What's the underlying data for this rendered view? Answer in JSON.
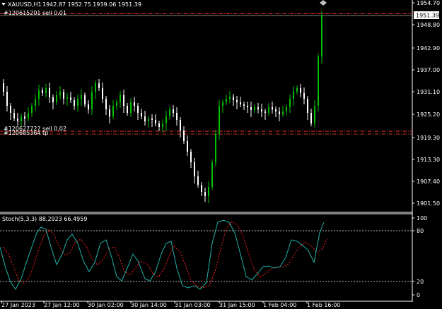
{
  "header": {
    "menu_icon": "triangle-down-icon",
    "symbol_label": "XAUUSD,H1",
    "ohlc_label": "1942.87 1952.75 1939.06 1951.39"
  },
  "orders": [
    {
      "label": "#120615201 sell 0.01"
    },
    {
      "label": "#120627727 sell 0.02"
    },
    {
      "label": "#120685364 tp"
    }
  ],
  "price_axis": {
    "ticks": [
      "1954.70",
      "1948.80",
      "1942.90",
      "1937.00",
      "1931.10",
      "1925.20",
      "1919.30",
      "1913.30",
      "1907.40",
      "1901.50"
    ],
    "current_price": "1951.39"
  },
  "indicator": {
    "label": "Stoch(5,3,3) 88.2923 66.4959",
    "ticks": [
      "100",
      "80",
      "20",
      "0"
    ]
  },
  "time_axis": {
    "ticks": [
      "27 Jan 2023",
      "27 Jan 12:00",
      "30 Jan 02:00",
      "30 Jan 14:00",
      "31 Jan 03:00",
      "31 Jan 15:00",
      "1 Feb 04:00",
      "1 Feb 16:00"
    ]
  },
  "colors": {
    "background": "#000000",
    "bull": "#00c000",
    "bear": "#ffffff",
    "axis": "#ffffff",
    "sell_line": "#ff0000",
    "tp_line": "#c04020",
    "stoch_main": "#20b2aa",
    "stoch_signal": "#ff0000",
    "price_box_bg": "#ffffff",
    "price_box_text": "#000000"
  }
}
